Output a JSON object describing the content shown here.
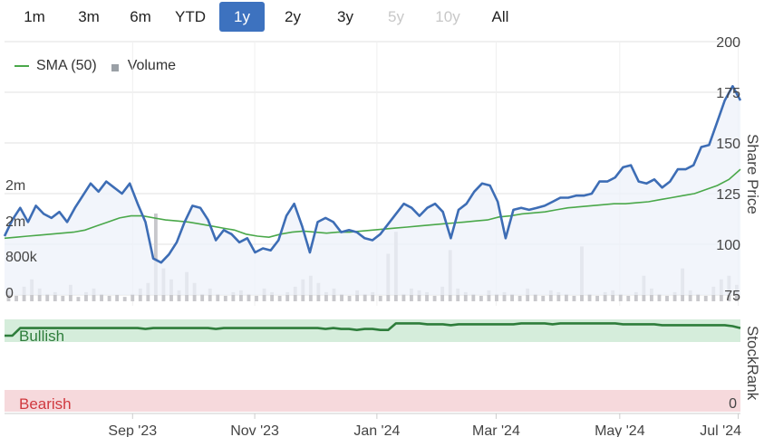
{
  "range_buttons": [
    {
      "label": "1m",
      "state": "normal"
    },
    {
      "label": "3m",
      "state": "normal"
    },
    {
      "label": "6m",
      "state": "normal"
    },
    {
      "label": "YTD",
      "state": "normal"
    },
    {
      "label": "1y",
      "state": "active"
    },
    {
      "label": "2y",
      "state": "normal"
    },
    {
      "label": "3y",
      "state": "normal"
    },
    {
      "label": "5y",
      "state": "disabled"
    },
    {
      "label": "10y",
      "state": "disabled"
    },
    {
      "label": "All",
      "state": "normal"
    }
  ],
  "legend": {
    "sma_label": "SMA (50)",
    "volume_label": "Volume"
  },
  "colors": {
    "price": "#3d6db5",
    "price_fill": "#eef2fa",
    "sma": "#4aa84a",
    "volume": "#c8c8cc",
    "grid": "#e2e2e2",
    "stockrank": "#2e7d3b",
    "bullish_band": "#d5eddb",
    "bearish_band": "#f6d9dc",
    "bullish_text": "#2e7d3b",
    "bearish_text": "#d0393f",
    "active_button": "#3d72bf"
  },
  "chart_data": [
    {
      "type": "line",
      "title": "",
      "ylabel": "Share Price",
      "ylim": [
        75,
        200
      ],
      "yticks": [
        "75",
        "100",
        "125",
        "150",
        "175",
        "200"
      ],
      "x_tick_labels": [
        "Sep '23",
        "Nov '23",
        "Jan '24",
        "Mar '24",
        "May '24",
        "Jul '24"
      ],
      "x_tick_fractions": [
        0.174,
        0.34,
        0.506,
        0.668,
        0.836,
        0.997
      ],
      "grid": true,
      "legend_position": "top-left",
      "series": [
        {
          "name": "SMA (50)",
          "kind": "line",
          "color": "#4aa84a",
          "values": [
            103,
            103.5,
            104,
            104.5,
            105,
            105.5,
            106,
            107,
            109,
            111,
            113,
            114,
            114,
            113,
            112,
            111.5,
            111,
            110,
            109,
            108,
            107,
            105,
            104,
            103.5,
            105,
            106,
            106.5,
            106,
            105.5,
            106,
            106,
            106.5,
            107,
            107.5,
            108,
            108.5,
            109,
            109.5,
            110,
            110.5,
            111,
            111.5,
            112,
            113.5,
            114,
            115,
            115.5,
            116,
            117,
            118,
            118.5,
            119,
            119.5,
            120,
            120,
            120.5,
            121,
            122,
            123,
            124,
            125,
            127,
            129,
            132,
            137
          ]
        },
        {
          "name": "Price",
          "kind": "area",
          "color": "#3d6db5",
          "values": [
            104,
            112,
            118,
            111,
            119,
            115,
            113,
            116,
            111,
            118,
            124,
            130,
            126,
            131,
            128,
            125,
            130,
            120,
            111,
            93,
            91,
            95,
            101,
            111,
            119,
            118,
            112,
            102,
            107,
            105,
            101,
            103,
            96,
            98,
            97,
            102,
            114,
            120,
            109,
            96,
            111,
            113,
            111,
            106,
            107,
            106,
            103,
            102,
            105,
            110,
            115,
            120,
            118,
            114,
            118,
            120,
            116,
            103,
            117,
            120,
            126,
            130,
            129,
            121,
            103,
            117,
            118,
            117,
            118,
            119,
            121,
            123,
            123,
            124,
            124,
            125,
            131,
            131,
            133,
            138,
            139,
            131,
            130,
            132,
            128,
            131,
            137,
            137,
            139,
            148,
            149,
            160,
            171,
            178,
            171
          ]
        }
      ]
    },
    {
      "type": "bar",
      "ylabel": "",
      "ylim": [
        0,
        2400000
      ],
      "yticks": [
        "0",
        "800k",
        "2m",
        "2m"
      ],
      "series": [
        {
          "name": "Volume",
          "values": [
            300000,
            150000,
            400000,
            600000,
            350000,
            200000,
            250000,
            150000,
            450000,
            120000,
            250000,
            350000,
            200000,
            150000,
            180000,
            120000,
            200000,
            350000,
            500000,
            2400000,
            900000,
            600000,
            300000,
            800000,
            500000,
            200000,
            350000,
            200000,
            150000,
            250000,
            300000,
            200000,
            150000,
            350000,
            250000,
            150000,
            250000,
            400000,
            600000,
            700000,
            500000,
            250000,
            350000,
            200000,
            150000,
            300000,
            200000,
            250000,
            150000,
            1300000,
            1900000,
            200000,
            350000,
            300000,
            250000,
            150000,
            400000,
            1400000,
            350000,
            250000,
            200000,
            150000,
            300000,
            200000,
            250000,
            200000,
            150000,
            350000,
            200000,
            150000,
            300000,
            250000,
            200000,
            150000,
            1500000,
            200000,
            150000,
            250000,
            300000,
            200000,
            150000,
            250000,
            700000,
            350000,
            200000,
            150000,
            250000,
            900000,
            300000,
            200000,
            150000,
            400000,
            600000,
            700000,
            450000
          ]
        }
      ]
    },
    {
      "type": "line",
      "ylabel": "StockRank",
      "ylim": [
        0,
        100
      ],
      "yticks": [
        "0"
      ],
      "bands": [
        "Bullish",
        "Bearish"
      ],
      "series": [
        {
          "name": "StockRank",
          "values": [
            80,
            80,
            88,
            88,
            88,
            88,
            88,
            88,
            88,
            88,
            88,
            88,
            88,
            88,
            88,
            88,
            88,
            88,
            87,
            88,
            88,
            88,
            88,
            88,
            88,
            88,
            88,
            87,
            88,
            88,
            88,
            88,
            88,
            88,
            88,
            88,
            88,
            88,
            88,
            88,
            88,
            87,
            88,
            87,
            87,
            86,
            87,
            87,
            86,
            86,
            93,
            93,
            93,
            93,
            92,
            92,
            92,
            91,
            92,
            92,
            92,
            92,
            92,
            92,
            92,
            92,
            93,
            93,
            93,
            93,
            92,
            93,
            93,
            93,
            93,
            93,
            93,
            93,
            93,
            92,
            92,
            92,
            92,
            92,
            91,
            91,
            91,
            91,
            91,
            91,
            91,
            91,
            91,
            90,
            88
          ]
        }
      ]
    }
  ]
}
